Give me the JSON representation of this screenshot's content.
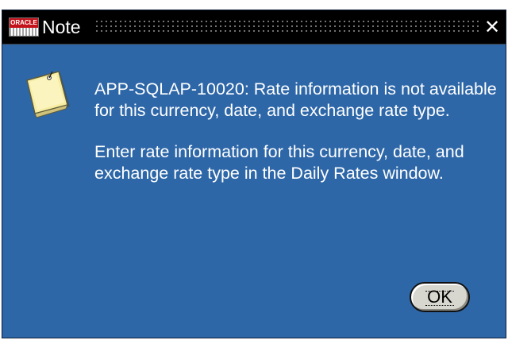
{
  "window": {
    "title": "Note",
    "logo_text": "ORACLE",
    "close_glyph": "✕"
  },
  "icons": {
    "app_logo": "oracle-applications-logo-icon",
    "note": "note-pad-icon",
    "close": "close-icon"
  },
  "message": {
    "line1": "APP-SQLAP-10020: Rate information is not available for this currency, date, and exchange rate type.",
    "line2": "Enter rate information for this currency, date, and exchange rate type in the Daily Rates window."
  },
  "buttons": {
    "ok_label": "OK"
  },
  "colors": {
    "dialog_background": "#2e67a8",
    "titlebar_background": "#000000",
    "text": "#ffffff",
    "button_face": "#d7d7cf"
  }
}
